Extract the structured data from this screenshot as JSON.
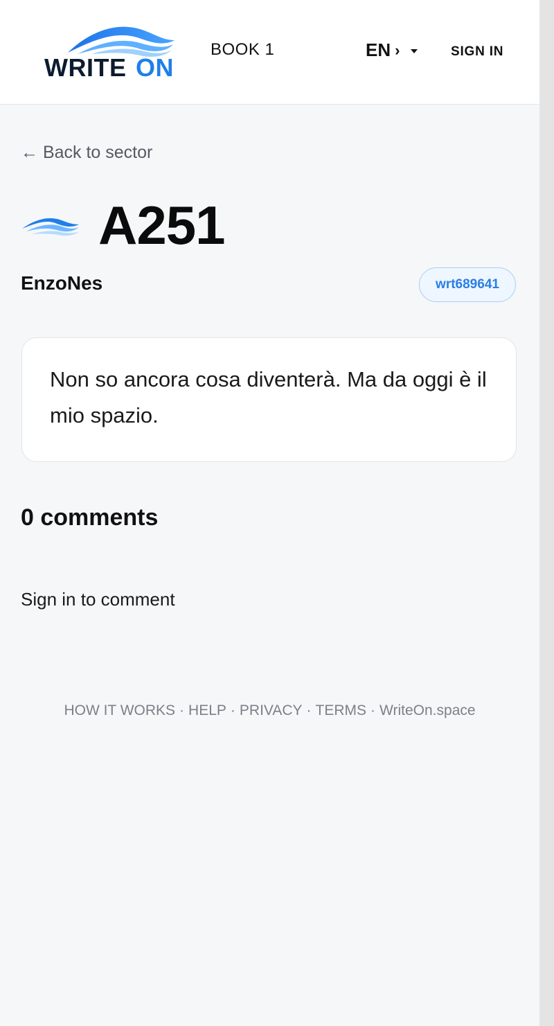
{
  "header": {
    "logo_text": "WRITEON",
    "book_label": "BOOK 1",
    "language": "EN",
    "language_chevron": "›",
    "signin_label": "SIGN IN"
  },
  "colors": {
    "brand_blue": "#1f7fe8",
    "brand_dark": "#0d1b2e",
    "badge_text": "#2a7ee6",
    "background": "#f6f7f9"
  },
  "post": {
    "back_link": "← Back to sector",
    "title": "A251",
    "author": "EnzoNes",
    "badge": "wrt689641",
    "text": "Non so ancora cosa diventerà. Ma da oggi è il mio spazio."
  },
  "comments": {
    "heading": "0 comments",
    "signin_prompt": "Sign in to comment"
  },
  "footer": {
    "links": [
      "HOW IT WORKS",
      "HELP",
      "PRIVACY",
      "TERMS",
      "WriteOn.space"
    ],
    "separator": "·"
  }
}
